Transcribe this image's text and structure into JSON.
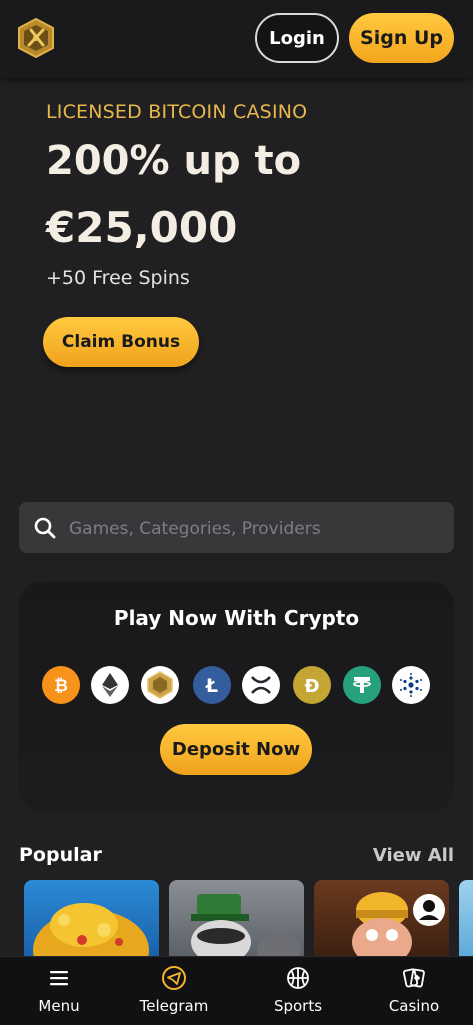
{
  "header": {
    "logo": "sword-crest-logo",
    "login_label": "Login",
    "signup_label": "Sign Up"
  },
  "hero": {
    "kicker": "LICENSED BITCOIN CASINO",
    "headline_line1": "200% up to",
    "headline_line2": "€25,000",
    "subline": "+50 Free Spins",
    "cta_label": "Claim Bonus"
  },
  "search": {
    "placeholder": "Games, Categories, Providers",
    "value": ""
  },
  "crypto": {
    "title": "Play Now With Crypto",
    "coins": [
      "bitcoin-icon",
      "ethereum-icon",
      "house-coin-icon",
      "litecoin-icon",
      "xrp-icon",
      "dogecoin-icon",
      "tether-icon",
      "cardano-icon"
    ],
    "deposit_label": "Deposit Now"
  },
  "popular": {
    "title": "Popular",
    "view_all": "View All"
  },
  "bottom_nav": {
    "items": [
      {
        "label": "Menu",
        "icon": "menu-icon"
      },
      {
        "label": "Telegram",
        "icon": "telegram-icon"
      },
      {
        "label": "Sports",
        "icon": "basketball-icon"
      },
      {
        "label": "Casino",
        "icon": "cards-icon"
      }
    ]
  },
  "colors": {
    "accent_gold": "#f6b52a",
    "background": "#202022",
    "card": "#1a1a1c"
  }
}
